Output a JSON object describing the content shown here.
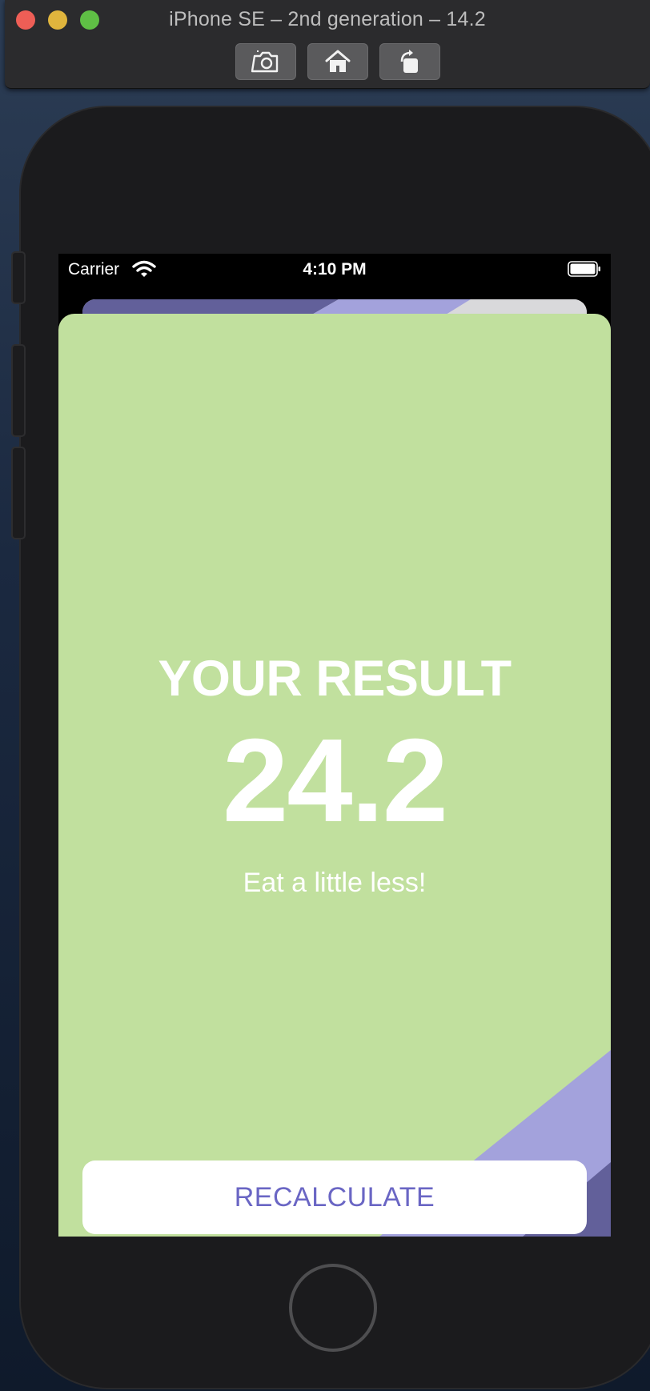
{
  "simulator": {
    "title": "iPhone SE – 2nd generation – 14.2",
    "toolbar": {
      "screenshot_icon": "camera-icon",
      "home_icon": "home-icon",
      "rotate_icon": "rotate-icon"
    }
  },
  "status_bar": {
    "carrier": "Carrier",
    "time": "4:10 PM",
    "wifi_icon": "wifi-icon",
    "battery_icon": "battery-icon"
  },
  "result": {
    "title": "YOUR RESULT",
    "value": "24.2",
    "advice": "Eat a little less!"
  },
  "actions": {
    "recalculate_label": "RECALCULATE"
  },
  "colors": {
    "sheet_background": "#c1e09e",
    "accent_purple": "#a3a2dc",
    "dark_purple": "#62609a",
    "button_text": "#6a66c4"
  }
}
